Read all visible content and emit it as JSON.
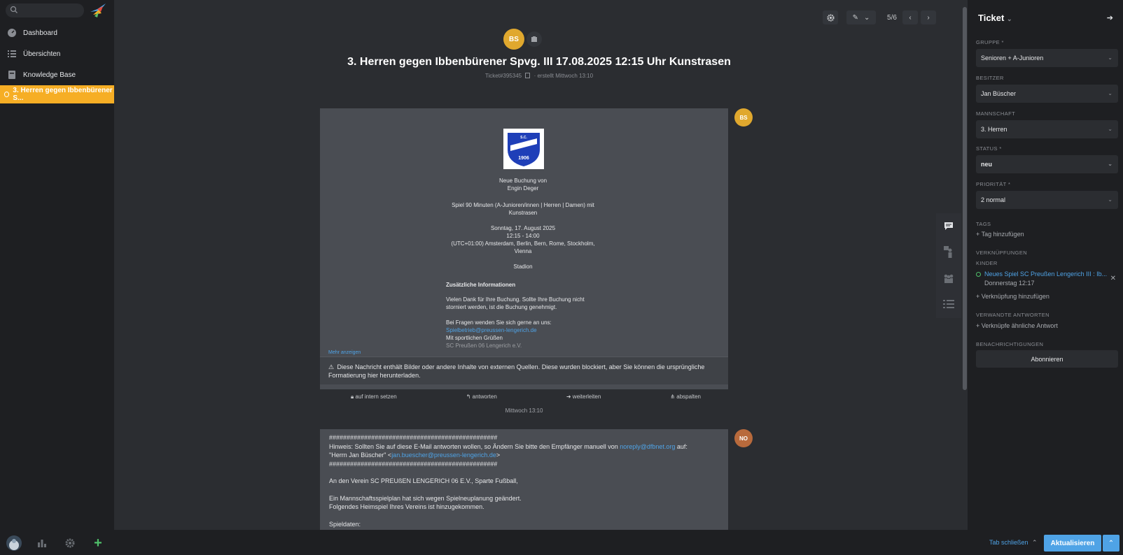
{
  "sidebar": {
    "search_placeholder": "",
    "items": [
      {
        "label": "Dashboard",
        "icon": "dashboard-icon"
      },
      {
        "label": "Übersichten",
        "icon": "list-icon"
      },
      {
        "label": "Knowledge Base",
        "icon": "book-icon"
      },
      {
        "label": "3. Herren gegen Ibbenbürener S...",
        "icon": "ticket-status-icon"
      }
    ]
  },
  "header": {
    "pager": "5/6",
    "avatar_initials": "BS"
  },
  "ticket": {
    "title": "3. Herren gegen Ibbenbürener Spvg. III 17.08.2025 12:15 Uhr Kunstrasen",
    "meta": "Ticket#395345",
    "meta_created": "· erstellt Mittwoch 13:10"
  },
  "article1": {
    "avatar": "BS",
    "logo_text": "S.C. PREUSSEN LENGERICH 1906",
    "lines": [
      "Neue Buchung von",
      "Engin Deger",
      "Spiel 90 Minuten (A-Junioren/innen | Herren | Damen) mit",
      "Kunstrasen",
      "Sonntag, 17. August 2025",
      "12:15 - 14:00",
      "(UTC+01:00) Amsterdam, Berlin, Bern, Rome, Stockholm,",
      "Vienna",
      "Stadion"
    ],
    "extra_title": "Zusätzliche Informationen",
    "extra_lines": [
      "Vielen Dank für Ihre Buchung. Sollte Ihre Buchung nicht",
      "storniert werden, ist die Buchung genehmigt."
    ],
    "contact_intro": "Bei Fragen wenden Sie sich gerne an uns:",
    "contact_email": "Spielbetrieb@preussen-lengerich.de",
    "closing": "Mit sportlichen Grüßen",
    "sender": "SC Preußen 06 Lengerich e.V.",
    "show_more": "Mehr anzeigen",
    "warning": "Diese Nachricht enthält Bilder oder andere Inhalte von externen Quellen. Diese wurden blockiert, aber Sie können die ursprüngliche Formatierung hier herunterladen.",
    "actions": [
      "auf intern setzen",
      "antworten",
      "weiterleiten",
      "abspalten"
    ],
    "timestamp": "Mittwoch 13:10"
  },
  "article2": {
    "avatar": "NO",
    "hash_line": "################################################",
    "hint_prefix": "Hinweis: Sollten Sie auf diese E-Mail antworten wollen, so Ändern Sie bitte den Empfänger manuell von ",
    "hint_email": "noreply@dfbnet.org",
    "hint_suffix": " auf:",
    "recipient_prefix": "\"Herrn Jan Büscher\" <",
    "recipient_email": "jan.buescher@preussen-lengerich.de",
    "recipient_suffix": ">",
    "line1": "An den Verein SC PREUßEN LENGERICH 06 E.V., Sparte Fußball,",
    "line2": "Ein Mannschaftsspielplan hat sich wegen Spielneuplanung geändert.",
    "line3": "Folgendes Heimspiel Ihres Vereins ist hinzugekommen.",
    "line4": "Spieldaten:"
  },
  "panel": {
    "title": "Ticket",
    "group_label": "GRUPPE *",
    "group_value": "Senioren + A-Junioren",
    "owner_label": "BESITZER",
    "owner_value": "Jan Büscher",
    "team_label": "MANNSCHAFT",
    "team_value": "3. Herren",
    "status_label": "STATUS *",
    "status_value": "neu",
    "priority_label": "PRIORITÄT *",
    "priority_value": "2 normal",
    "tags_label": "TAGS",
    "tags_add": "+ Tag hinzufügen",
    "links_label": "VERKNÜPFUNGEN",
    "children_label": "KINDER",
    "child_title": "Neues Spiel SC Preußen Lengerich III : Ib...",
    "child_date": "Donnerstag 12:17",
    "link_add": "+ Verknüpfung hinzufügen",
    "related_label": "VERWANDTE ANTWORTEN",
    "related_add": "+ Verknüpfe ähnliche Antwort",
    "notify_label": "BENACHRICHTIGUNGEN",
    "subscribe": "Abonnieren"
  },
  "footer": {
    "close_tab": "Tab schließen",
    "update": "Aktualisieren"
  },
  "colors": {
    "accent": "#f6ae25",
    "primary": "#4fa3e6",
    "avatar_bs": "#e0a82e",
    "avatar_no": "#b86a3c"
  }
}
